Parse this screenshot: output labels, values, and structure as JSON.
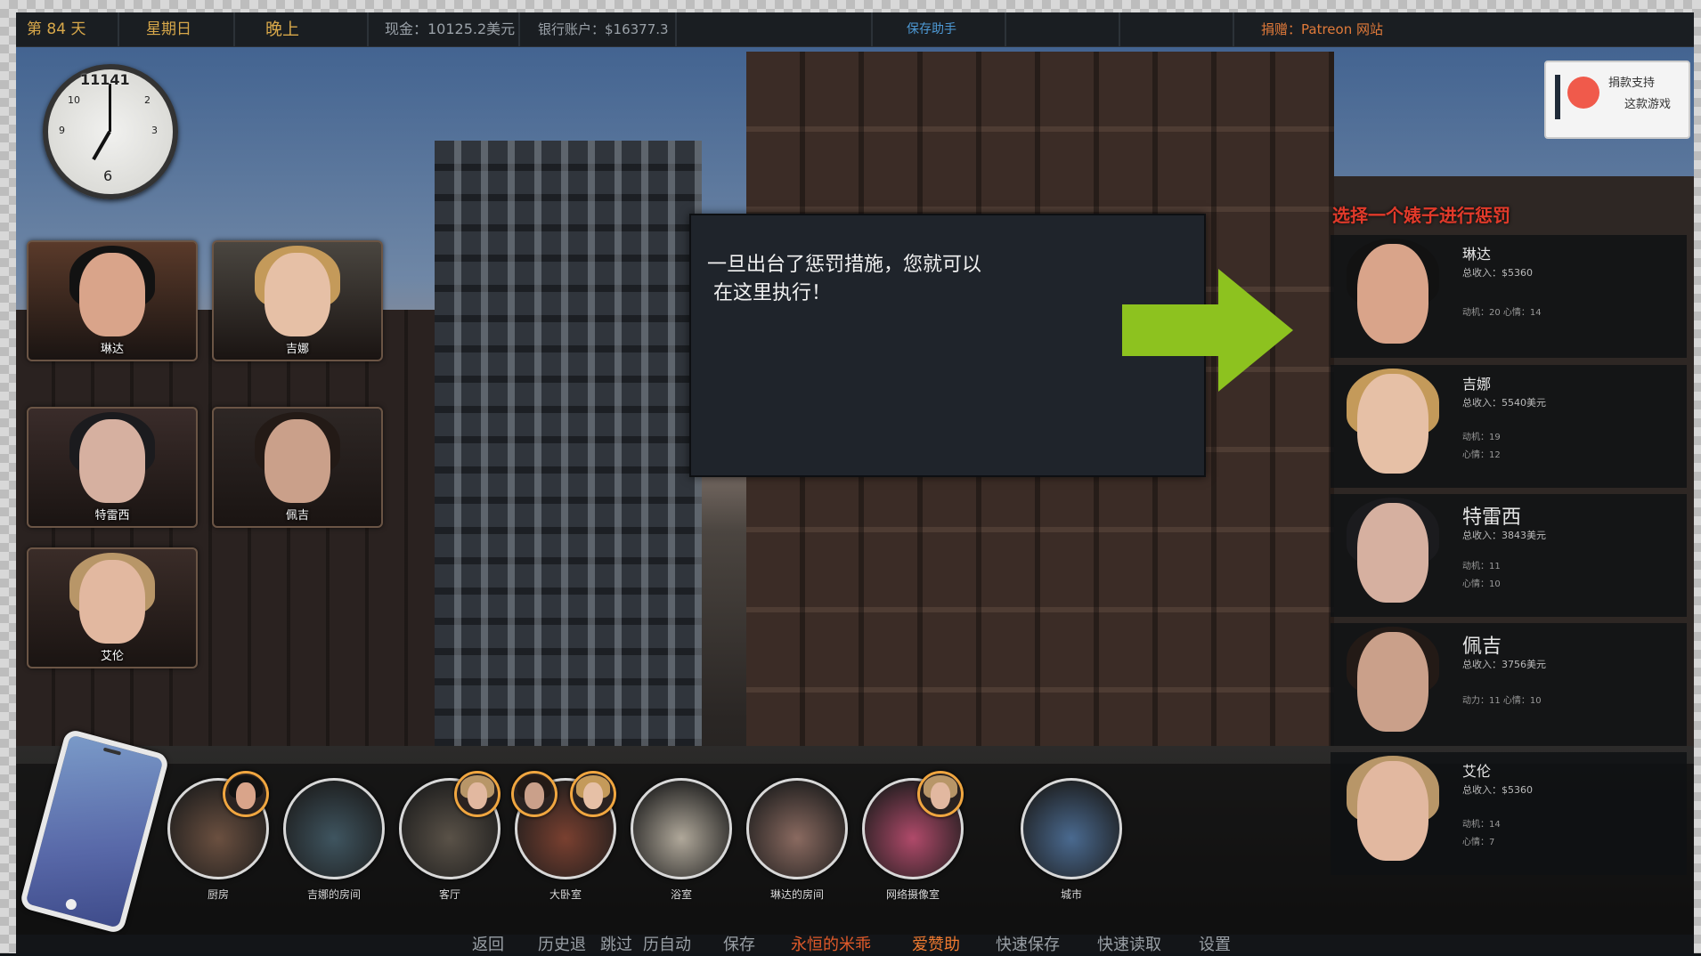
{
  "topbar": {
    "day": "第 84 天",
    "weekday": "星期日",
    "time_of_day": "晚上",
    "cash": "现金：10125.2美元",
    "bank": "银行账户：$16377.3",
    "save_helper": "保存助手",
    "donate_link": "捐赠：Patreon 网站"
  },
  "clock": {
    "label": "11141",
    "hour": 7,
    "minute": 0,
    "numbers": [
      "10",
      "9",
      "6",
      "3",
      "2"
    ]
  },
  "characters": [
    {
      "name": "琳达",
      "hair": "#121212",
      "skin": "#d9a48a",
      "bg": "#5a3a2a"
    },
    {
      "name": "吉娜",
      "hair": "#c49a5a",
      "skin": "#e6c0a6",
      "bg": "#4a4640"
    },
    {
      "name": "特雷西",
      "hair": "#1b1b1e",
      "skin": "#d6b0a0",
      "bg": "#3a2c2a"
    },
    {
      "name": "佩吉",
      "hair": "#231a16",
      "skin": "#caa08a",
      "bg": "#2e2725"
    },
    {
      "name": "艾伦",
      "hair": "#b89668",
      "skin": "#e2b8a0",
      "bg": "#3a2c28"
    }
  ],
  "dialog": {
    "line1": "一旦出台了惩罚措施，您就可以",
    "line2": "在这里执行！"
  },
  "panel": {
    "title": "选择一个婊子进行惩罚",
    "cards": [
      {
        "name": "琳达",
        "income": "总收入：$5360",
        "stat1": "动机：20 心情：14",
        "stat2": "",
        "hair": "#121212",
        "skin": "#d9a48a"
      },
      {
        "name": "吉娜",
        "income": "总收入：5540美元",
        "stat1": "动机：19",
        "stat2": "心情：12",
        "hair": "#c49a5a",
        "skin": "#e6c0a6"
      },
      {
        "name": "特雷西",
        "income": "总收入：3843美元",
        "stat1": "动机：11",
        "stat2": "心情：10",
        "hair": "#1b1b1e",
        "skin": "#d6b0a0"
      },
      {
        "name": "佩吉",
        "income": "总收入：3756美元",
        "stat1": "动力：11 心情：10",
        "stat2": "",
        "hair": "#231a16",
        "skin": "#caa08a"
      },
      {
        "name": "艾伦",
        "income": "总收入：$5360",
        "stat1": "动机：14",
        "stat2": "心情：7",
        "hair": "#b89668",
        "skin": "#e2b8a0"
      }
    ]
  },
  "donate": {
    "line1": "捐款支持",
    "line2": "这款游戏"
  },
  "rooms": [
    {
      "label": "厨房",
      "color": "#6b5040",
      "badges": [
        {
          "hair": "#121212",
          "skin": "#d9a48a"
        }
      ]
    },
    {
      "label": "吉娜的房间",
      "color": "#3f5560",
      "badges": []
    },
    {
      "label": "客厅",
      "color": "#5a5248",
      "badges": [
        {
          "hair": "#b89668",
          "skin": "#e2b8a0"
        }
      ]
    },
    {
      "label": "大卧室",
      "color": "#7a4030",
      "badges": [
        {
          "hair": "#231a16",
          "skin": "#caa08a"
        },
        {
          "hair": "#c49a5a",
          "skin": "#e6c0a6"
        }
      ]
    },
    {
      "label": "浴室",
      "color": "#b0a89a",
      "badges": []
    },
    {
      "label": "琳达的房间",
      "color": "#8a6a60",
      "badges": []
    },
    {
      "label": "网络摄像室",
      "color": "#b04a6a",
      "badges": [
        {
          "hair": "#b89668",
          "skin": "#e2b8a0"
        }
      ]
    },
    {
      "label": "城市",
      "color": "#4a6a90",
      "badges": []
    }
  ],
  "bottom_menu": [
    "返回",
    "历史退",
    "跳过",
    "历自动",
    "保存",
    "永恒的米乖",
    "爱赞助",
    "快速保存",
    "快速读取",
    "设置"
  ],
  "colors": {
    "accent_red": "#e23a2a",
    "arrow_green": "#8dc21f",
    "badge_orange": "#f0a640"
  }
}
